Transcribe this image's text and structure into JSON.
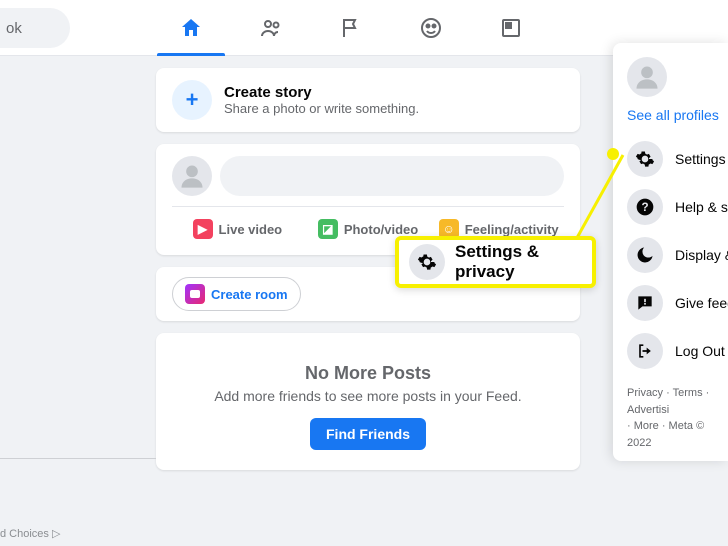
{
  "topnav": {
    "search_fragment": "ok"
  },
  "story": {
    "title": "Create story",
    "sub": "Share a photo or write something."
  },
  "composer": {
    "actions": [
      {
        "label": "Live video"
      },
      {
        "label": "Photo/video"
      },
      {
        "label": "Feeling/activity"
      }
    ]
  },
  "room": {
    "button": "Create room"
  },
  "empty": {
    "title": "No More Posts",
    "sub": "Add more friends to see more posts in your Feed.",
    "button": "Find Friends"
  },
  "dropdown": {
    "see_all": "See all profiles",
    "items": [
      {
        "label": "Settings & priv"
      },
      {
        "label": "Help & support"
      },
      {
        "label": "Display & acce"
      },
      {
        "label": "Give feedback"
      },
      {
        "label": "Log Out"
      }
    ],
    "footer_l1": "Privacy · Terms · Advertisi",
    "footer_l2": "· More · Meta © 2022"
  },
  "callout": {
    "label": "Settings & privacy"
  },
  "bottom": {
    "text": "d Choices ▷"
  }
}
